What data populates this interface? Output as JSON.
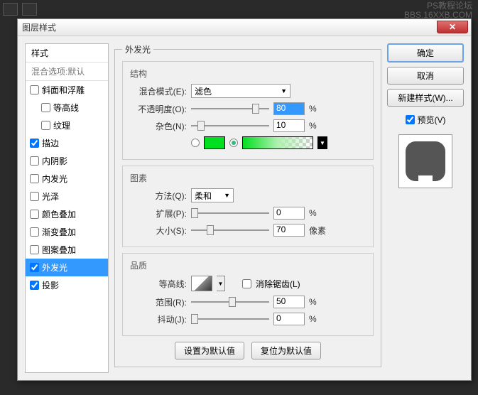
{
  "watermark": {
    "line1": "PS教程论坛",
    "line2": "BBS.16XXB.COM"
  },
  "bg_buttons": [
    "...",
    "..."
  ],
  "dialog": {
    "title": "图层样式",
    "close_glyph": "✕"
  },
  "styles_panel": {
    "header": "样式",
    "sub": "混合选项:默认",
    "items": [
      {
        "label": "斜面和浮雕",
        "checked": false,
        "indent": false
      },
      {
        "label": "等高线",
        "checked": false,
        "indent": true
      },
      {
        "label": "纹理",
        "checked": false,
        "indent": true
      },
      {
        "label": "描边",
        "checked": true,
        "indent": false
      },
      {
        "label": "内阴影",
        "checked": false,
        "indent": false
      },
      {
        "label": "内发光",
        "checked": false,
        "indent": false
      },
      {
        "label": "光泽",
        "checked": false,
        "indent": false
      },
      {
        "label": "颜色叠加",
        "checked": false,
        "indent": false
      },
      {
        "label": "渐变叠加",
        "checked": false,
        "indent": false
      },
      {
        "label": "图案叠加",
        "checked": false,
        "indent": false
      },
      {
        "label": "外发光",
        "checked": true,
        "indent": false,
        "selected": true
      },
      {
        "label": "投影",
        "checked": true,
        "indent": false
      }
    ]
  },
  "outer_glow": {
    "legend": "外发光",
    "structure": {
      "title": "结构",
      "blend_label": "混合模式(E):",
      "blend_value": "滤色",
      "opacity_label": "不透明度(O):",
      "opacity_value": "80",
      "opacity_unit": "%",
      "noise_label": "杂色(N):",
      "noise_value": "10",
      "noise_unit": "%",
      "solid_color": "#00e020"
    },
    "elements": {
      "title": "图素",
      "technique_label": "方法(Q):",
      "technique_value": "柔和",
      "spread_label": "扩展(P):",
      "spread_value": "0",
      "spread_unit": "%",
      "size_label": "大小(S):",
      "size_value": "70",
      "size_unit": "像素"
    },
    "quality": {
      "title": "品质",
      "contour_label": "等高线:",
      "antialias_label": "消除锯齿(L)",
      "range_label": "范围(R):",
      "range_value": "50",
      "range_unit": "%",
      "jitter_label": "抖动(J):",
      "jitter_value": "0",
      "jitter_unit": "%"
    },
    "defaults": {
      "set": "设置为默认值",
      "reset": "复位为默认值"
    }
  },
  "right": {
    "ok": "确定",
    "cancel": "取消",
    "new_style": "新建样式(W)...",
    "preview": "预览(V)"
  }
}
